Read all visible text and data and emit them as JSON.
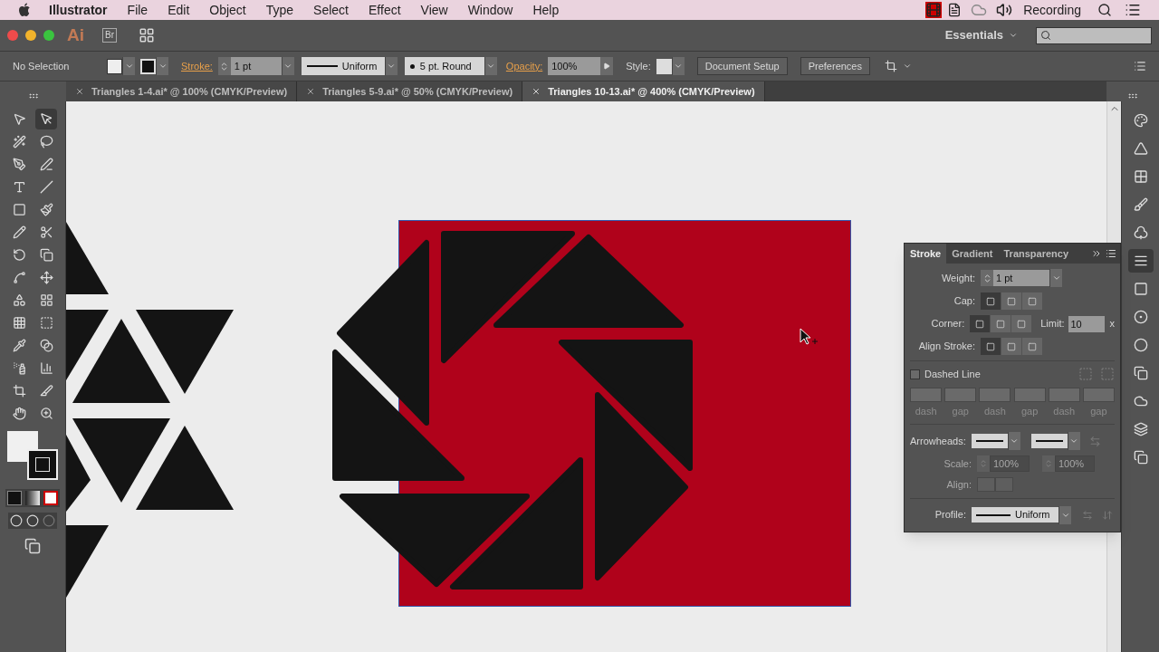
{
  "menu_bar": {
    "app": "Illustrator",
    "menus": [
      "File",
      "Edit",
      "Object",
      "Type",
      "Select",
      "Effect",
      "View",
      "Window",
      "Help"
    ],
    "status_text": "Recording"
  },
  "app_bar": {
    "logo": "Ai",
    "bridge": "Br",
    "workspace": "Essentials"
  },
  "control_bar": {
    "selection": "No Selection",
    "stroke_label": "Stroke:",
    "stroke_weight": "1 pt",
    "profile": "Uniform",
    "brush": "5 pt. Round",
    "opacity_label": "Opacity:",
    "opacity": "100%",
    "style_label": "Style:",
    "buttons": [
      "Document Setup",
      "Preferences"
    ]
  },
  "doc_tabs": [
    {
      "label": "Triangles 1-4.ai* @ 100% (CMYK/Preview)",
      "selected": false
    },
    {
      "label": "Triangles 5-9.ai* @ 50% (CMYK/Preview)",
      "selected": false
    },
    {
      "label": "Triangles 10-13.ai* @ 400% (CMYK/Preview)",
      "selected": true
    }
  ],
  "tools": [
    {
      "selected": false
    },
    {
      "selected": true
    },
    {
      "selected": false
    },
    {
      "selected": false
    },
    {
      "selected": false
    },
    {
      "selected": false
    },
    {
      "selected": false
    },
    {
      "selected": false
    },
    {
      "selected": false
    },
    {
      "selected": false
    },
    {
      "selected": false
    },
    {
      "selected": false
    },
    {
      "selected": false
    },
    {
      "selected": false
    },
    {
      "selected": false
    },
    {
      "selected": false
    },
    {
      "selected": false
    },
    {
      "selected": false
    },
    {
      "selected": false
    },
    {
      "selected": false
    },
    {
      "selected": false
    },
    {
      "selected": false
    },
    {
      "selected": false
    },
    {
      "selected": false
    },
    {
      "selected": false
    },
    {
      "selected": false
    },
    {
      "selected": false
    },
    {
      "selected": false
    }
  ],
  "dock": [
    {
      "selected": false
    },
    {
      "selected": false
    },
    {
      "selected": false
    },
    {
      "selected": false
    },
    {
      "selected": false
    },
    {
      "selected": true
    },
    {
      "selected": false
    },
    {
      "selected": false
    },
    {
      "selected": false
    },
    {
      "selected": false
    },
    {
      "selected": false
    },
    {
      "selected": false
    },
    {
      "selected": false
    }
  ],
  "stroke_panel": {
    "tabs": [
      {
        "label": "Stroke",
        "selected": true
      },
      {
        "label": "Gradient",
        "selected": false
      },
      {
        "label": "Transparency",
        "selected": false
      }
    ],
    "weight_label": "Weight:",
    "weight": "1 pt",
    "cap_label": "Cap:",
    "cap_options": [
      {
        "selected": true
      },
      {
        "selected": false
      },
      {
        "selected": false
      }
    ],
    "corner_label": "Corner:",
    "corner_options": [
      {
        "selected": true
      },
      {
        "selected": false
      },
      {
        "selected": false
      }
    ],
    "limit_label": "Limit:",
    "limit": "10",
    "limit_unit": "x",
    "align_label": "Align Stroke:",
    "align_options": [
      {
        "selected": true
      },
      {
        "selected": false
      },
      {
        "selected": false
      }
    ],
    "dashed": {
      "label": "Dashed Line",
      "checked": false
    },
    "dash_labels": [
      "dash",
      "gap",
      "dash",
      "gap",
      "dash",
      "gap"
    ],
    "arrowheads_label": "Arrowheads:",
    "scale_label": "Scale:",
    "scale_start": "100%",
    "scale_end": "100%",
    "align_arrow_label": "Align:",
    "arrows_disabled": true,
    "profile_label": "Profile:",
    "profile": "Uniform"
  }
}
